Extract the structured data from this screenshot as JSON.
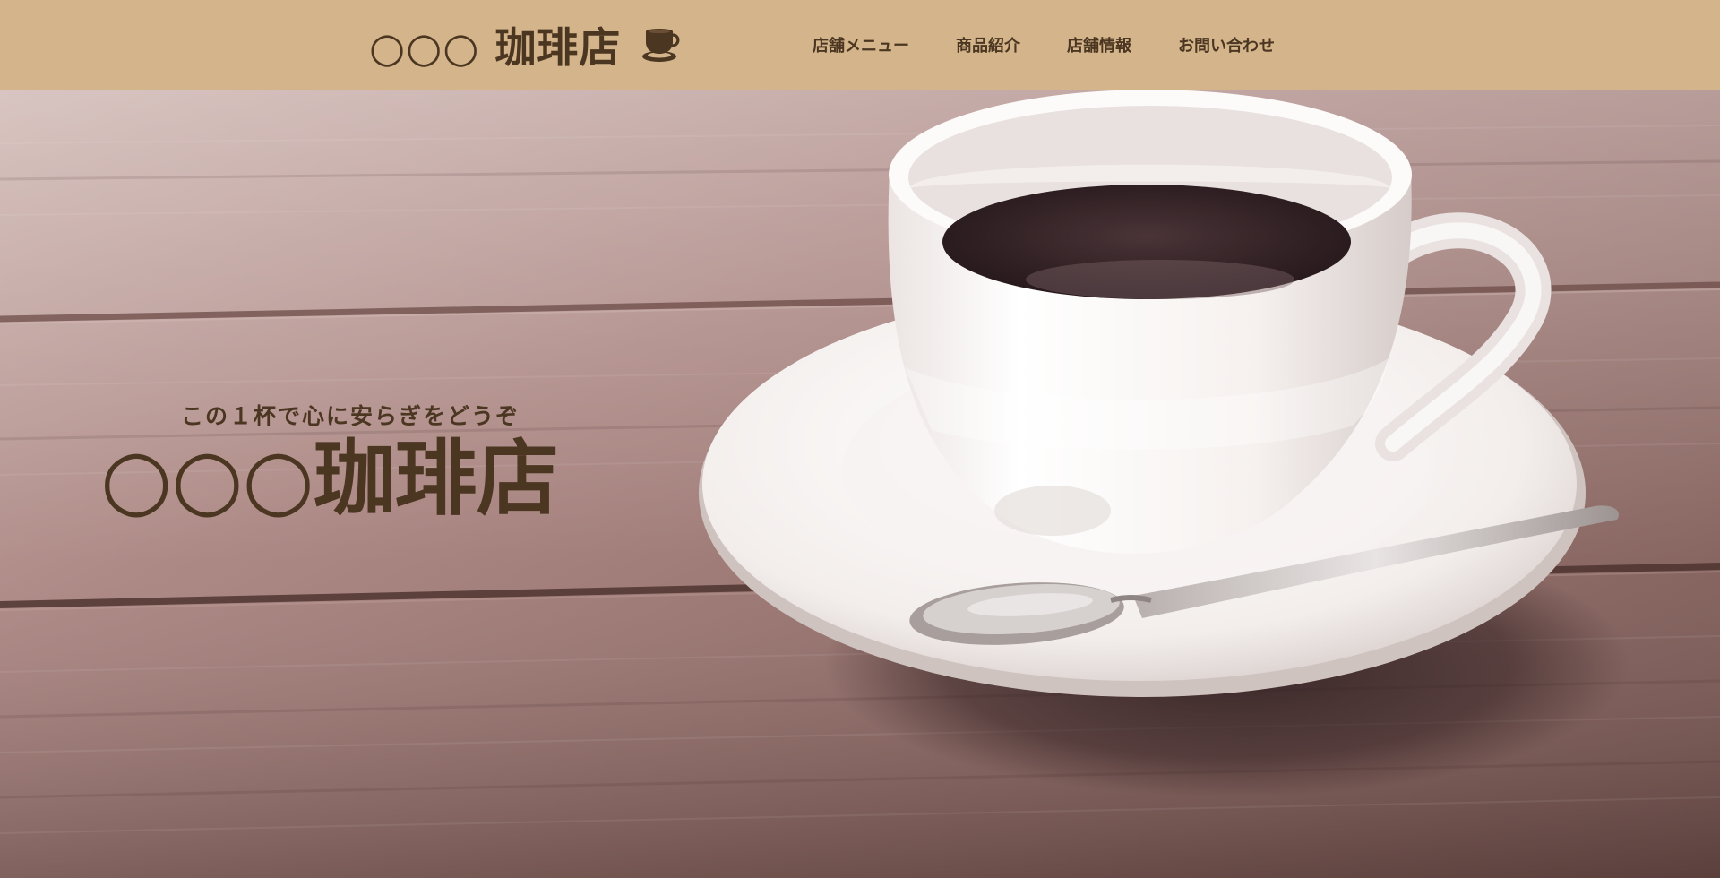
{
  "header": {
    "logo_text": "○○○ 珈琲店",
    "logo_icon": "coffee-cup-icon",
    "background_color": "#d3b48b",
    "text_color": "#4b3621"
  },
  "nav": {
    "items": [
      {
        "label": "店舗メニュー"
      },
      {
        "label": "商品紹介"
      },
      {
        "label": "店舗情報"
      },
      {
        "label": "お問い合わせ"
      }
    ]
  },
  "hero": {
    "tagline": "この１杯で心に安らぎをどうぞ",
    "title": "○○○珈琲店",
    "image": "coffee-cup-on-wooden-table-photo"
  }
}
